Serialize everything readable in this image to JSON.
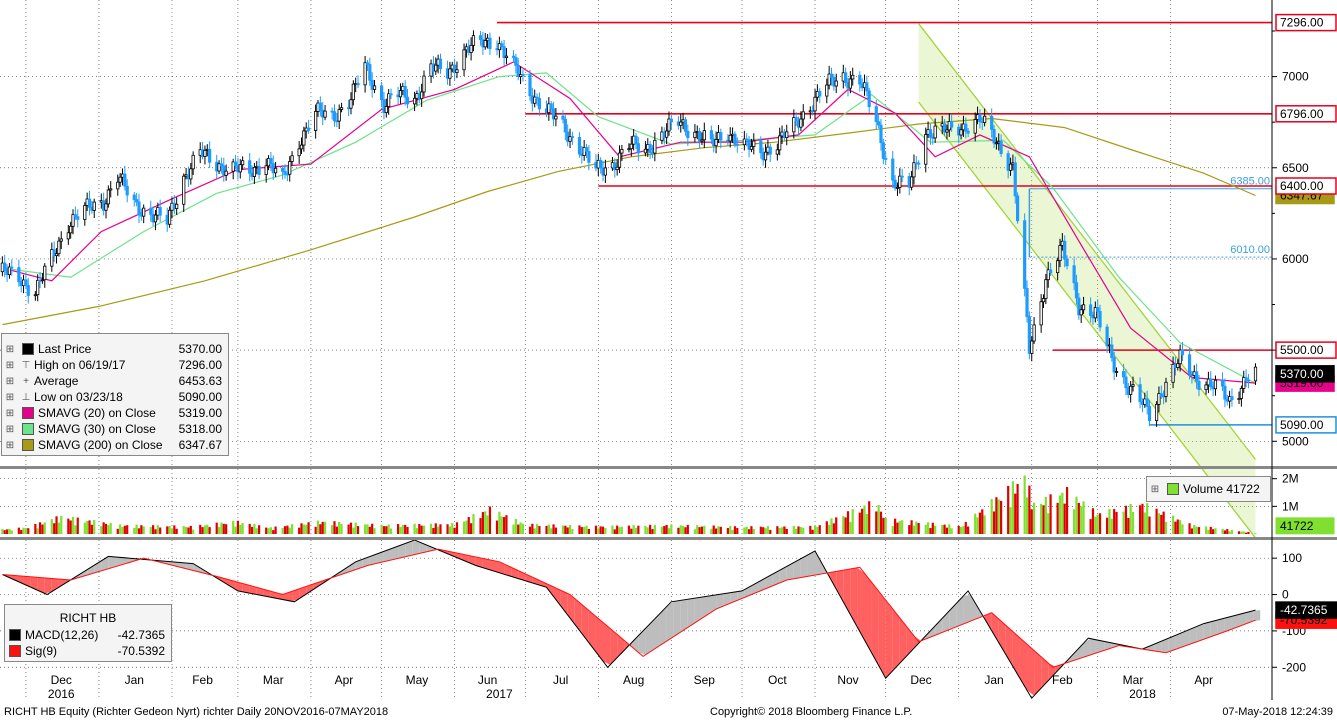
{
  "chart_data": {
    "type": "candlestick",
    "ticker": "RICHT HB Equity (Richter Gedeon Nyrt) richter",
    "period": "Daily 20NOV2016-07MAY2018",
    "x_tick_labels": [
      "Dec",
      "Jan",
      "Feb",
      "Mar",
      "Apr",
      "May",
      "Jun",
      "Jul",
      "Aug",
      "Sep",
      "Oct",
      "Nov",
      "Dec",
      "Jan",
      "Feb",
      "Mar",
      "Apr"
    ],
    "year_labels": [
      "2016",
      "2017",
      "2018"
    ],
    "price_axis": {
      "ticks": [
        5000,
        5500,
        6000,
        6500,
        7000
      ],
      "ylim": [
        4870,
        7420
      ]
    },
    "price_series": [
      [
        "2016-11-21",
        5930
      ],
      [
        "2016-11-28",
        5900
      ],
      [
        "2016-12-05",
        5820
      ],
      [
        "2016-12-12",
        6000
      ],
      [
        "2016-12-19",
        6200
      ],
      [
        "2016-12-28",
        6280
      ],
      [
        "2017-01-03",
        6320
      ],
      [
        "2017-01-09",
        6450
      ],
      [
        "2017-01-16",
        6300
      ],
      [
        "2017-01-23",
        6250
      ],
      [
        "2017-01-30",
        6200
      ],
      [
        "2017-02-06",
        6450
      ],
      [
        "2017-02-13",
        6580
      ],
      [
        "2017-02-20",
        6520
      ],
      [
        "2017-02-27",
        6500
      ],
      [
        "2017-03-06",
        6470
      ],
      [
        "2017-03-13",
        6550
      ],
      [
        "2017-03-20",
        6420
      ],
      [
        "2017-03-27",
        6650
      ],
      [
        "2017-04-03",
        6800
      ],
      [
        "2017-04-10",
        6780
      ],
      [
        "2017-04-18",
        6880
      ],
      [
        "2017-04-24",
        7050
      ],
      [
        "2017-05-02",
        6850
      ],
      [
        "2017-05-08",
        6900
      ],
      [
        "2017-05-15",
        6880
      ],
      [
        "2017-05-22",
        7050
      ],
      [
        "2017-05-29",
        7020
      ],
      [
        "2017-06-06",
        7150
      ],
      [
        "2017-06-12",
        7180
      ],
      [
        "2017-06-19",
        7200
      ],
      [
        "2017-06-26",
        7050
      ],
      [
        "2017-07-03",
        6920
      ],
      [
        "2017-07-10",
        6820
      ],
      [
        "2017-07-17",
        6720
      ],
      [
        "2017-07-24",
        6620
      ],
      [
        "2017-07-31",
        6480
      ],
      [
        "2017-08-07",
        6520
      ],
      [
        "2017-08-14",
        6620
      ],
      [
        "2017-08-21",
        6600
      ],
      [
        "2017-08-28",
        6680
      ],
      [
        "2017-09-04",
        6750
      ],
      [
        "2017-09-11",
        6700
      ],
      [
        "2017-09-18",
        6620
      ],
      [
        "2017-09-25",
        6700
      ],
      [
        "2017-10-02",
        6620
      ],
      [
        "2017-10-09",
        6580
      ],
      [
        "2017-10-16",
        6640
      ],
      [
        "2017-10-23",
        6720
      ],
      [
        "2017-10-30",
        6850
      ],
      [
        "2017-11-06",
        6950
      ],
      [
        "2017-11-13",
        7000
      ],
      [
        "2017-11-20",
        6980
      ],
      [
        "2017-11-27",
        6750
      ],
      [
        "2017-12-04",
        6420
      ],
      [
        "2017-12-11",
        6400
      ],
      [
        "2017-12-18",
        6700
      ],
      [
        "2017-12-27",
        6700
      ],
      [
        "2018-01-03",
        6730
      ],
      [
        "2018-01-10",
        6760
      ],
      [
        "2018-01-17",
        6650
      ],
      [
        "2018-01-24",
        6500
      ],
      [
        "2018-01-31",
        5500
      ],
      [
        "2018-02-07",
        5900
      ],
      [
        "2018-02-14",
        6050
      ],
      [
        "2018-02-21",
        5750
      ],
      [
        "2018-02-28",
        5700
      ],
      [
        "2018-03-07",
        5450
      ],
      [
        "2018-03-14",
        5300
      ],
      [
        "2018-03-23",
        5150
      ],
      [
        "2018-03-29",
        5300
      ],
      [
        "2018-04-05",
        5450
      ],
      [
        "2018-04-12",
        5350
      ],
      [
        "2018-04-19",
        5300
      ],
      [
        "2018-04-26",
        5220
      ],
      [
        "2018-05-03",
        5350
      ],
      [
        "2018-05-07",
        5370
      ]
    ],
    "sma_series": {
      "sma20": [
        [
          "2016-11-21",
          5950
        ],
        [
          "2016-12-12",
          5880
        ],
        [
          "2017-01-02",
          6150
        ],
        [
          "2017-02-01",
          6330
        ],
        [
          "2017-03-01",
          6490
        ],
        [
          "2017-04-01",
          6520
        ],
        [
          "2017-05-01",
          6820
        ],
        [
          "2017-06-01",
          6930
        ],
        [
          "2017-06-26",
          7080
        ],
        [
          "2017-07-20",
          6880
        ],
        [
          "2017-08-10",
          6560
        ],
        [
          "2017-09-05",
          6640
        ],
        [
          "2017-10-01",
          6640
        ],
        [
          "2017-10-25",
          6680
        ],
        [
          "2017-11-15",
          6930
        ],
        [
          "2017-12-05",
          6800
        ],
        [
          "2017-12-22",
          6560
        ],
        [
          "2018-01-10",
          6680
        ],
        [
          "2018-01-31",
          6560
        ],
        [
          "2018-02-20",
          6120
        ],
        [
          "2018-03-15",
          5620
        ],
        [
          "2018-04-10",
          5350
        ],
        [
          "2018-05-07",
          5319
        ]
      ],
      "sma30": [
        [
          "2016-11-21",
          5950
        ],
        [
          "2016-12-20",
          5900
        ],
        [
          "2017-01-20",
          6150
        ],
        [
          "2017-02-20",
          6360
        ],
        [
          "2017-03-20",
          6460
        ],
        [
          "2017-04-20",
          6640
        ],
        [
          "2017-05-20",
          6870
        ],
        [
          "2017-06-20",
          7000
        ],
        [
          "2017-07-10",
          7020
        ],
        [
          "2017-08-01",
          6780
        ],
        [
          "2017-09-01",
          6630
        ],
        [
          "2017-10-01",
          6650
        ],
        [
          "2017-11-01",
          6680
        ],
        [
          "2017-11-25",
          6900
        ],
        [
          "2017-12-20",
          6640
        ],
        [
          "2018-01-20",
          6650
        ],
        [
          "2018-02-10",
          6390
        ],
        [
          "2018-03-10",
          5900
        ],
        [
          "2018-04-05",
          5540
        ],
        [
          "2018-05-07",
          5318
        ]
      ],
      "sma200": [
        [
          "2016-11-21",
          5640
        ],
        [
          "2017-01-01",
          5740
        ],
        [
          "2017-02-15",
          5880
        ],
        [
          "2017-04-01",
          6050
        ],
        [
          "2017-05-15",
          6230
        ],
        [
          "2017-06-15",
          6370
        ],
        [
          "2017-07-15",
          6480
        ],
        [
          "2017-08-15",
          6560
        ],
        [
          "2017-09-15",
          6610
        ],
        [
          "2017-10-15",
          6640
        ],
        [
          "2017-11-15",
          6690
        ],
        [
          "2017-12-15",
          6740
        ],
        [
          "2018-01-15",
          6770
        ],
        [
          "2018-02-15",
          6720
        ],
        [
          "2018-03-15",
          6600
        ],
        [
          "2018-04-15",
          6470
        ],
        [
          "2018-05-07",
          6347.67
        ]
      ]
    },
    "horizontal_levels": [
      {
        "value": 7296,
        "label": "7296.00",
        "from": "2017-06-19"
      },
      {
        "value": 6796,
        "label": "6796.00",
        "from": "2017-07-01"
      },
      {
        "value": 6400,
        "label": "6400.00",
        "from": "2017-08-01"
      },
      {
        "value": 5500,
        "label": "5500.00",
        "from": "2018-02-10"
      },
      {
        "value": 5090,
        "label": "5090.00",
        "from": "2018-03-23"
      }
    ],
    "price_tags": [
      {
        "label": "7296.00",
        "value": 7296,
        "kind": "red"
      },
      {
        "label": "6796.00",
        "value": 6796,
        "kind": "red"
      },
      {
        "label": "6400.00",
        "value": 6400,
        "kind": "red"
      },
      {
        "label": "6347.67",
        "value": 6347.67,
        "kind": "sma200"
      },
      {
        "label": "5500.00",
        "value": 5500,
        "kind": "red"
      },
      {
        "label": "5370.00",
        "value": 5370,
        "kind": "last"
      },
      {
        "label": "5319.00",
        "value": 5319,
        "kind": "sma20"
      },
      {
        "label": "5090.00",
        "value": 5090,
        "kind": "blue"
      }
    ],
    "fib_levels": [
      {
        "value": 6385,
        "label": "6385.00"
      },
      {
        "value": 6010,
        "label": "6010.00"
      }
    ],
    "channel": {
      "upper": [
        [
          "2017-12-15",
          7290
        ],
        [
          "2018-05-07",
          4900
        ]
      ],
      "lower": [
        [
          "2017-12-15",
          6860
        ],
        [
          "2018-05-07",
          4470
        ]
      ]
    },
    "volume_axis": {
      "ticks": [
        {
          "value": 2000000,
          "label": "2M"
        },
        {
          "value": 1000000,
          "label": "1M"
        }
      ],
      "ylim": [
        0,
        2350000
      ]
    },
    "volume_series": [
      [
        "2016-11-21",
        180000
      ],
      [
        "2016-12-01",
        250000
      ],
      [
        "2016-12-16",
        700000
      ],
      [
        "2017-01-10",
        350000
      ],
      [
        "2017-02-10",
        300000
      ],
      [
        "2017-02-28",
        500000
      ],
      [
        "2017-03-15",
        250000
      ],
      [
        "2017-04-05",
        500000
      ],
      [
        "2017-05-01",
        350000
      ],
      [
        "2017-06-01",
        400000
      ],
      [
        "2017-06-16",
        1000000
      ],
      [
        "2017-07-01",
        380000
      ],
      [
        "2017-08-01",
        300000
      ],
      [
        "2017-09-01",
        350000
      ],
      [
        "2017-10-01",
        280000
      ],
      [
        "2017-11-01",
        300000
      ],
      [
        "2017-11-27",
        1300000
      ],
      [
        "2017-12-01",
        600000
      ],
      [
        "2018-01-02",
        300000
      ],
      [
        "2018-01-29",
        2300000
      ],
      [
        "2018-02-02",
        1200000
      ],
      [
        "2018-02-16",
        1700000
      ],
      [
        "2018-03-01",
        800000
      ],
      [
        "2018-03-20",
        1200000
      ],
      [
        "2018-04-10",
        350000
      ],
      [
        "2018-05-07",
        41722
      ]
    ],
    "volume_last": {
      "label": "41722"
    },
    "macd_axis": {
      "ticks": [
        {
          "value": 100,
          "label": "100"
        },
        {
          "value": 0,
          "label": "0"
        },
        {
          "value": -100,
          "label": "-100"
        },
        {
          "value": -200,
          "label": "-200"
        }
      ],
      "ylim": [
        -290,
        150
      ]
    },
    "macd_series": [
      [
        "2016-11-21",
        55
      ],
      [
        "2016-12-10",
        0
      ],
      [
        "2017-01-05",
        105
      ],
      [
        "2017-02-10",
        85
      ],
      [
        "2017-03-01",
        10
      ],
      [
        "2017-03-25",
        -20
      ],
      [
        "2017-04-20",
        90
      ],
      [
        "2017-05-15",
        150
      ],
      [
        "2017-06-10",
        80
      ],
      [
        "2017-07-10",
        20
      ],
      [
        "2017-08-05",
        -200
      ],
      [
        "2017-09-01",
        -20
      ],
      [
        "2017-10-01",
        10
      ],
      [
        "2017-11-01",
        120
      ],
      [
        "2017-12-01",
        -230
      ],
      [
        "2018-01-05",
        10
      ],
      [
        "2018-02-01",
        -285
      ],
      [
        "2018-02-25",
        -120
      ],
      [
        "2018-03-20",
        -150
      ],
      [
        "2018-04-15",
        -80
      ],
      [
        "2018-05-07",
        -42.7365
      ]
    ],
    "signal_series": [
      [
        "2016-11-21",
        55
      ],
      [
        "2016-12-20",
        40
      ],
      [
        "2017-01-20",
        100
      ],
      [
        "2017-02-20",
        50
      ],
      [
        "2017-03-20",
        0
      ],
      [
        "2017-04-25",
        80
      ],
      [
        "2017-05-25",
        125
      ],
      [
        "2017-06-20",
        90
      ],
      [
        "2017-07-20",
        0
      ],
      [
        "2017-08-20",
        -170
      ],
      [
        "2017-09-20",
        -40
      ],
      [
        "2017-10-20",
        40
      ],
      [
        "2017-11-20",
        75
      ],
      [
        "2017-12-15",
        -130
      ],
      [
        "2018-01-15",
        -50
      ],
      [
        "2018-02-10",
        -200
      ],
      [
        "2018-03-10",
        -140
      ],
      [
        "2018-03-30",
        -160
      ],
      [
        "2018-04-25",
        -100
      ],
      [
        "2018-05-07",
        -70.5392
      ]
    ],
    "macd_tags": [
      {
        "label": "-42.7365",
        "value": -42.7365,
        "kind": "macd"
      },
      {
        "label": "-70.5392",
        "value": -70.5392,
        "kind": "signal"
      }
    ],
    "colors": {
      "candle_up": "#000000",
      "candle_down": "#1f9bff",
      "sma20": "#e6008a",
      "sma30": "#6de38a",
      "sma200": "#a89a16",
      "level": "#e8001c",
      "fib": "#3aa0e0",
      "channel": "#a3d43a",
      "macd": "#000000",
      "signal": "#ff1010",
      "volume_up": "#7fe030",
      "volume_down": "#e00000",
      "grid": "#555555"
    }
  },
  "price_legend": {
    "rows": [
      {
        "label": "Last Price",
        "value": "5370.00",
        "icon": "square",
        "color": "#000000"
      },
      {
        "label": "High on 06/19/17",
        "value": "7296.00",
        "icon": "high-marker",
        "color": "#666666"
      },
      {
        "label": "Average",
        "value": "6453.63",
        "icon": "average-marker",
        "color": "#666666"
      },
      {
        "label": "Low on 03/23/18",
        "value": "5090.00",
        "icon": "low-marker",
        "color": "#666666"
      },
      {
        "label": "SMAVG (20)  on Close",
        "value": "5319.00",
        "icon": "square",
        "color": "#e6008a"
      },
      {
        "label": "SMAVG (30)  on Close",
        "value": "5318.00",
        "icon": "square",
        "color": "#6de38a"
      },
      {
        "label": "SMAVG (200)  on Close",
        "value": "6347.67",
        "icon": "square",
        "color": "#a89a16"
      }
    ]
  },
  "macd_legend": {
    "title": "RICHT HB",
    "rows": [
      {
        "label": "MACD(12,26)",
        "value": "-42.7365",
        "color": "#000000"
      },
      {
        "label": "Sig(9)",
        "value": "-70.5392",
        "color": "#ff1010"
      }
    ]
  },
  "volume_legend": {
    "label": "Volume",
    "value": "41722",
    "color": "#7fe030"
  },
  "footer": {
    "left": "RICHT HB Equity (Richter Gedeon Nyrt) richter   Daily 20NOV2016-07MAY2018",
    "center": "Copyright© 2018 Bloomberg Finance L.P.",
    "right": "07-May-2018 12:24:39"
  }
}
